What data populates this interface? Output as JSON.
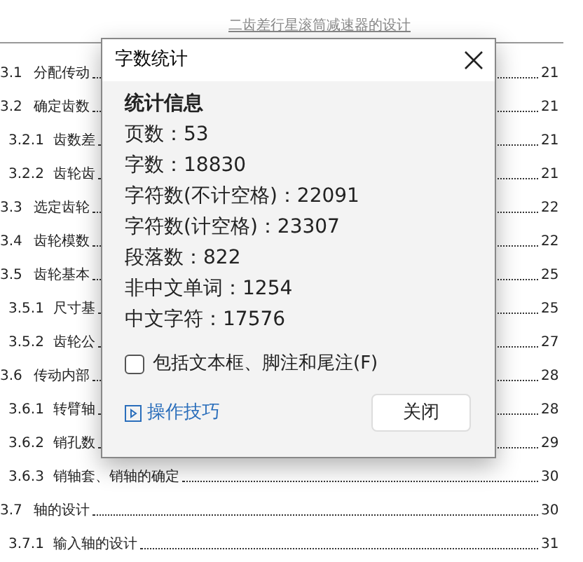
{
  "document": {
    "header": "二齿差行星滚筒减速器的设计",
    "toc": [
      {
        "number": "3.1",
        "title": "分配传动",
        "page": "21"
      },
      {
        "number": "3.2",
        "title": "确定齿数",
        "page": "21",
        "children": [
          {
            "number": "3.2.1",
            "title": "齿数差",
            "page": "21"
          },
          {
            "number": "3.2.2",
            "title": "齿轮齿",
            "page": "21"
          }
        ]
      },
      {
        "number": "3.3",
        "title": "选定齿轮",
        "page": "22"
      },
      {
        "number": "3.4",
        "title": "齿轮模数",
        "page": "22"
      },
      {
        "number": "3.5",
        "title": "齿轮基本",
        "page": "25",
        "children": [
          {
            "number": "3.5.1",
            "title": "尺寸基",
            "page": "25"
          },
          {
            "number": "3.5.2",
            "title": "齿轮公",
            "page": "27"
          }
        ]
      },
      {
        "number": "3.6",
        "title": "传动内部",
        "page": "28",
        "children": [
          {
            "number": "3.6.1",
            "title": "转臂轴",
            "page": "28"
          },
          {
            "number": "3.6.2",
            "title": "销孔数",
            "page": "29"
          },
          {
            "number": "3.6.3",
            "title": "销轴套、销轴的确定",
            "page": "30"
          }
        ]
      },
      {
        "number": "3.7",
        "title": "轴的设计",
        "page": "30",
        "children": [
          {
            "number": "3.7.1",
            "title": "输入轴的设计",
            "page": "31"
          }
        ]
      }
    ]
  },
  "dialog": {
    "title": "字数统计",
    "section_title": "统计信息",
    "stats": [
      "页数：53",
      "字数：18830",
      "字符数(不计空格)：22091",
      "字符数(计空格)：23307",
      "段落数：822",
      "非中文单词：1254",
      "中文字符：17576"
    ],
    "checkbox": {
      "label": "包括文本框、脚注和尾注(F)",
      "checked": false
    },
    "tips_link": "操作技巧",
    "close_button": "关闭"
  }
}
